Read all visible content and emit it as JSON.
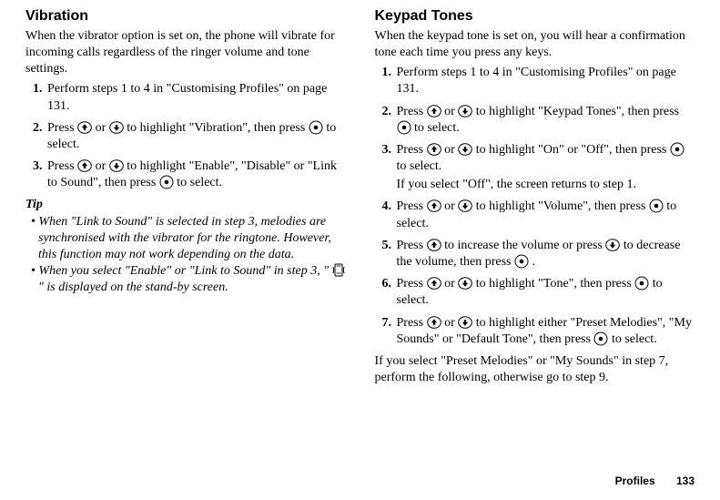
{
  "left": {
    "heading": "Vibration",
    "intro": "When the vibrator option is set on, the phone will vibrate for incoming calls regardless of the ringer volume and tone settings.",
    "s1a": "Perform steps 1 to 4 in \"Customising Profiles\" on page 131.",
    "s2a": "Press ",
    "s2b": " or ",
    "s2c": " to highlight \"Vibration\", then press ",
    "s2d": " to select.",
    "s3a": "Press ",
    "s3b": " or ",
    "s3c": " to highlight \"Enable\", \"Disable\" or \"Link to Sound\", then press ",
    "s3d": " to select.",
    "tip_label": "Tip",
    "tip1": "• When \"Link to Sound\" is selected in step 3, melodies are synchronised with the vibrator for the ringtone. However, this function may not work depending on the data.",
    "tip2a": "• When you select \"Enable\" or \"Link to Sound\" in step 3, \" ",
    "tip2b": " \" is displayed on the stand-by screen."
  },
  "right": {
    "heading": "Keypad Tones",
    "intro": "When the keypad tone is set on, you will hear a confirmation tone each time you press any keys.",
    "s1a": "Perform steps 1 to 4 in \"Customising Profiles\" on page 131.",
    "s2a": "Press ",
    "s2b": " or ",
    "s2c": " to highlight \"Keypad Tones\", then press ",
    "s2d": " to select.",
    "s3a": "Press ",
    "s3b": " or ",
    "s3c": " to highlight \"On\" or \"Off\", then press ",
    "s3d": " to select.",
    "s3e": "If you select \"Off\", the screen returns to step 1.",
    "s4a": "Press ",
    "s4b": " or ",
    "s4c": " to highlight \"Volume\", then press ",
    "s4d": " to select.",
    "s5a": "Press ",
    "s5b": " to increase the volume or press ",
    "s5c": " to decrease the volume, then press ",
    "s5d": " .",
    "s6a": "Press ",
    "s6b": " or ",
    "s6c": " to highlight \"Tone\", then press ",
    "s6d": " to select.",
    "s7a": "Press ",
    "s7b": " or ",
    "s7c": " to highlight either \"Preset Melodies\", \"My Sounds\" or \"Default Tone\", then press ",
    "s7d": " to select.",
    "after": "If you select \"Preset Melodies\" or \"My Sounds\" in step 7, perform the following, otherwise go to step 9."
  },
  "footer_section": "Profiles",
  "footer_page": "133"
}
